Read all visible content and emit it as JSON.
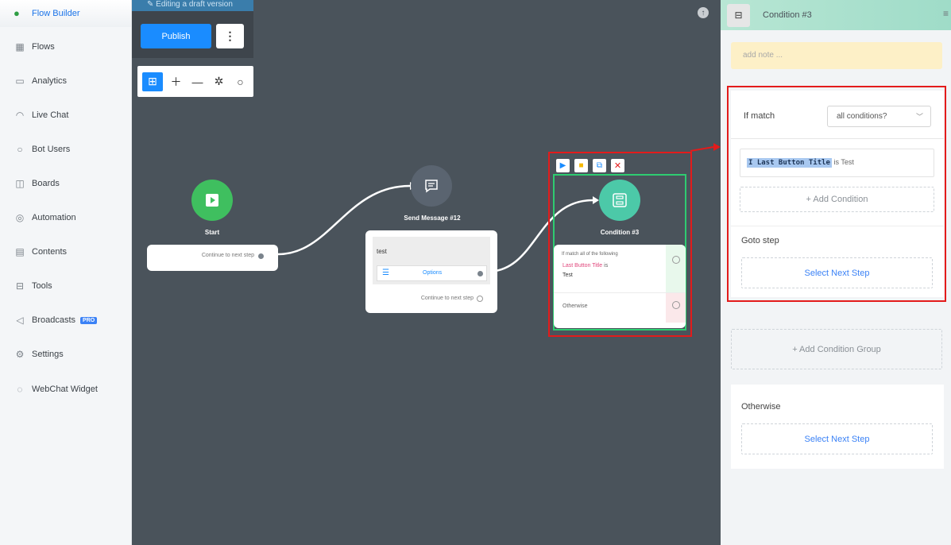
{
  "sidebar": {
    "brand": "Flow Builder",
    "items": [
      {
        "label": "Flows",
        "icon": "grid-icon"
      },
      {
        "label": "Analytics",
        "icon": "analytics-icon"
      },
      {
        "label": "Live Chat",
        "icon": "headset-icon"
      },
      {
        "label": "Bot Users",
        "icon": "user-icon"
      },
      {
        "label": "Boards",
        "icon": "board-icon"
      },
      {
        "label": "Automation",
        "icon": "automation-icon"
      },
      {
        "label": "Contents",
        "icon": "contents-icon"
      },
      {
        "label": "Tools",
        "icon": "tools-icon"
      },
      {
        "label": "Broadcasts",
        "icon": "megaphone-icon",
        "badge": "PRO"
      },
      {
        "label": "Settings",
        "icon": "gear-icon"
      },
      {
        "label": "WebChat Widget",
        "icon": "chat-icon"
      }
    ]
  },
  "canvas": {
    "draft_label": "Editing a draft version",
    "publish_label": "Publish",
    "start": {
      "title": "Start",
      "continue": "Continue to next step"
    },
    "send_message": {
      "title": "Send Message #12",
      "text": "test",
      "options": "Options",
      "continue": "Continue to next step"
    },
    "condition": {
      "title": "Condition #3",
      "if_text": "If match all of the following",
      "field": "Last Button Title",
      "is": "is",
      "value": "Test",
      "otherwise": "Otherwise"
    }
  },
  "panel": {
    "title": "Condition #3",
    "note_placeholder": "add note ...",
    "if_match_label": "If match",
    "match_select": "all conditions?",
    "condition_field": "Last Button Title",
    "condition_op": "is",
    "condition_value": "Test",
    "add_condition": "+ Add Condition",
    "goto_label": "Goto step",
    "select_next_step": "Select Next Step",
    "add_group": "+ Add Condition Group",
    "otherwise_label": "Otherwise",
    "otherwise_select": "Select Next Step"
  },
  "colors": {
    "accent": "#1a8cff",
    "start": "#3fbf5f",
    "condition": "#4cc9a8",
    "highlight_red": "#e31b1b",
    "selection_green": "#2ecc71"
  }
}
